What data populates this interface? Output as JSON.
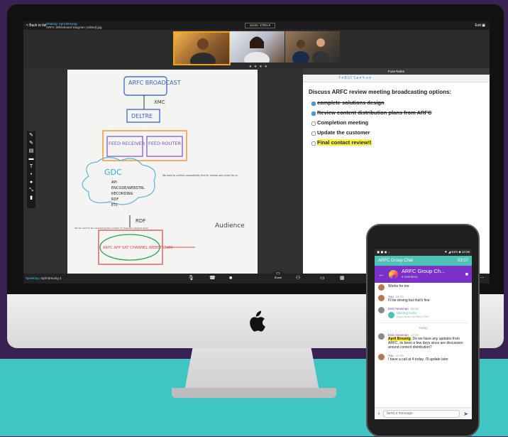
{
  "app": {
    "back_label": "< Back to list",
    "sharing_label": "Sharing: April Breunig",
    "sharing_file": "ARFC Whiteboard Diagram (edited).jpg",
    "zoom_label": "Zoom: 175% ▾",
    "exit_label": "Exit ▣",
    "video_dots": "● ● ● ●"
  },
  "whiteboard": {
    "nodes": [
      "ARFC BROADCAST",
      "DELTRE",
      "FEED RECEIVER",
      "FEED ROUTER",
      "GDC",
      "RDF",
      "ARFC APP SAT CHANNEL WEBSTREAM",
      "Audience"
    ],
    "list": [
      "API",
      "ENCODE/WEBSTRL",
      "RECORDING",
      "RDF",
      "ETC"
    ],
    "xmc": "XMC",
    "note_right": "We need to confirm compatibility first for release and install for us",
    "note_left": "We do need to be considering the number of channels required here!"
  },
  "tools": [
    "✎",
    "✎",
    "▤",
    "▬",
    "T",
    "•",
    "●",
    "⤡",
    "▮"
  ],
  "notes": {
    "header": "Fuse Notes",
    "toolbar": "Ŧ ▾   B U I T̶   ● ▾  ✎   ≡ ▾",
    "title": "Discuss ARFC review meeting broadcasting options:",
    "items": [
      {
        "text": "complete solutions design",
        "done": true
      },
      {
        "text": "Review content distribution plans from ARFC",
        "done": true
      },
      {
        "text": "Completion meeting",
        "done": false
      },
      {
        "text": "Update the customer",
        "done": false
      },
      {
        "text": "Final contact review!!",
        "done": false,
        "highlight": true
      }
    ]
  },
  "bottombar": {
    "speaking_label": "Speaking:",
    "speaker": "April Breunig 4",
    "share_label": "Share",
    "more": "⋯"
  },
  "phone": {
    "status_left": "▣ ◼ ◉ ...",
    "status_right": "▼ ◢ 61% ■ 13:28",
    "notif_title": "ARFC Group Chat",
    "notif_time": "03:07",
    "group_name": "ARFC Group Ch...",
    "group_members": "6 members",
    "first_msg": "Works for me",
    "msgs": [
      {
        "name": "You",
        "time": "09:35",
        "text": "I'll be driving but that's fine"
      },
      {
        "name": "Elvin Newman",
        "time": "09:35",
        "invite_title": "Meeting Invite",
        "invite_url": "https://fuze.me/38417994"
      },
      {
        "name": "Elvin Newman",
        "time": "12:35",
        "mention": "April Breunig",
        "text": ". Do we have any updates from ARFC, its been a few days since are discussion around content distribution?"
      },
      {
        "name": "You",
        "time": "12:35",
        "text": "I have a call at 4 today, I'll update later"
      }
    ],
    "today": "Today",
    "placeholder": "Send a message"
  }
}
